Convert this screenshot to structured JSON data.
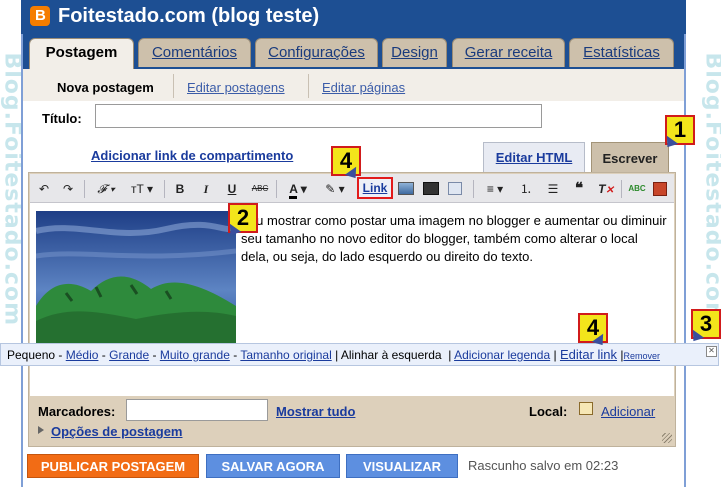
{
  "watermark": "Blog.Foitestado.com",
  "blog_title": "Foitestado.com (blog teste)",
  "main_tabs": [
    {
      "label": "Postagem",
      "active": true
    },
    {
      "label": "Comentários",
      "active": false
    },
    {
      "label": "Configurações",
      "active": false
    },
    {
      "label": "Design",
      "active": false
    },
    {
      "label": "Gerar receita",
      "active": false
    },
    {
      "label": "Estatísticas",
      "active": false
    }
  ],
  "sub_tabs": [
    {
      "label": "Nova postagem",
      "active": true
    },
    {
      "label": "Editar postagens",
      "active": false
    },
    {
      "label": "Editar páginas",
      "active": false
    }
  ],
  "title_field": {
    "label": "Título:",
    "value": ""
  },
  "share_link": "Adicionar link de compartimento",
  "editor_tabs": {
    "html": "Editar HTML",
    "compose": "Escrever"
  },
  "toolbar": {
    "link": "Link",
    "icons": [
      "undo-icon",
      "redo-icon",
      "font-family-icon",
      "font-size-icon",
      "bold-icon",
      "italic-icon",
      "underline-icon",
      "strikethrough-icon",
      "text-color-icon",
      "highlight-icon",
      "link-icon",
      "image-icon",
      "video-icon",
      "jump-break-icon",
      "align-icon",
      "numbered-list-icon",
      "bullet-list-icon",
      "quote-icon",
      "remove-format-icon",
      "spellcheck-icon",
      "rtl-icon"
    ],
    "glyphs": {
      "undo": "↶",
      "redo": "↷",
      "font": "𝓕",
      "size": "тT",
      "bold": "B",
      "italic": "I",
      "underline": "U",
      "strike": "ABC",
      "color": "A",
      "spell": "ABC"
    }
  },
  "editor_text": "Vou mostrar como postar uma imagem no blogger e aumentar ou diminuir seu tamanho no novo editor do blogger, também como alterar  o local dela, ou seja, do lado esquerdo ou direito do texto.",
  "image_bubble": {
    "sizes": [
      "Pequeno",
      "Médio",
      "Grande",
      "Muito grande",
      "Tamanho original"
    ],
    "align_current": "Alinhar à esquerda",
    "add_caption": "Adicionar legenda",
    "edit_link": "Editar link",
    "remove": "Remover"
  },
  "labels_field": {
    "label": "Marcadores:",
    "value": "",
    "show_all": "Mostrar tudo"
  },
  "location": {
    "label": "Local:",
    "add": "Adicionar"
  },
  "post_options": "Opções de postagem",
  "buttons": {
    "publish": "PUBLICAR POSTAGEM",
    "save": "SALVAR AGORA",
    "preview": "VISUALIZAR"
  },
  "draft_status": "Rascunho salvo em 02:23",
  "callouts": [
    "1",
    "2",
    "3",
    "4",
    "4"
  ],
  "colors": {
    "header_blue": "#1d4f93",
    "publish_orange": "#f26c15",
    "save_blue": "#5d8fe0",
    "callout_yellow": "#f3e51b",
    "callout_border": "#d11b1b"
  }
}
